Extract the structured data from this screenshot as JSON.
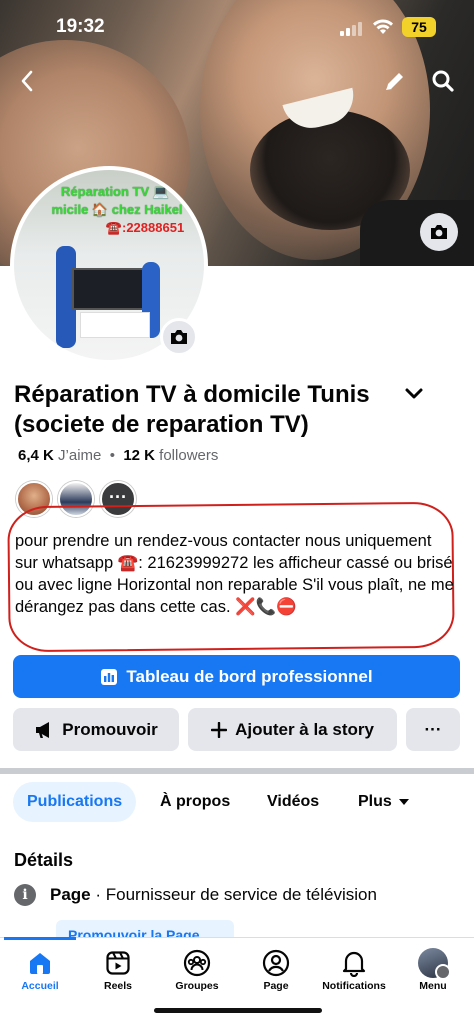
{
  "status": {
    "time": "19:32",
    "battery": "75"
  },
  "profile": {
    "name": "Réparation TV à domicile Tunis (societe de reparation TV)",
    "likes_count": "6,4 K",
    "likes_label": "J’aime",
    "followers_count": "12 K",
    "followers_label": "followers",
    "more_friends": "···",
    "picture_text": {
      "line1": "Réparation TV 💻",
      "line2": "micile 🏠 chez Haikel",
      "line3": "☎️:22888651"
    }
  },
  "bio": "pour prendre un rendez-vous contacter nous uniquement  sur whatsapp ☎️: 21623999272 les afficheur cassé ou brisé ou avec ligne Horizontal non reparable S'il vous plaît, ne me dérangez pas dans cette cas. ❌📞⛔",
  "actions": {
    "dashboard": "Tableau de bord professionnel",
    "promote": "Promouvoir",
    "story": "Ajouter à la story",
    "more": "···"
  },
  "tabs": [
    {
      "label": "Publications"
    },
    {
      "label": "À propos"
    },
    {
      "label": "Vidéos"
    },
    {
      "label": "Plus"
    }
  ],
  "details": {
    "title": "Détails",
    "type_label": "Page",
    "category": "· Fournisseur de service de télévision",
    "promote_page": "Promouvoir la Page"
  },
  "bottom_nav": [
    {
      "label": "Accueil",
      "icon": "home-icon"
    },
    {
      "label": "Reels",
      "icon": "reels-icon"
    },
    {
      "label": "Groupes",
      "icon": "groups-icon"
    },
    {
      "label": "Page",
      "icon": "page-icon"
    },
    {
      "label": "Notifications",
      "icon": "bell-icon"
    },
    {
      "label": "Menu",
      "icon": "menu-avatar"
    }
  ],
  "colors": {
    "accent": "#1877f2",
    "annotation": "#d0201c",
    "battery": "#f2d12b"
  }
}
